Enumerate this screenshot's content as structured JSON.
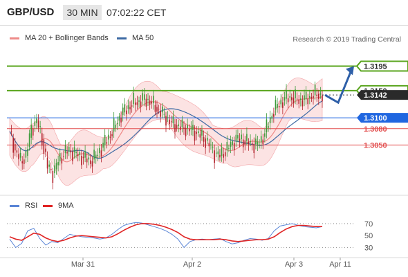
{
  "header": {
    "pair": "GBP/USD",
    "timeframe": "30 MIN",
    "time": "07:02:22 CET"
  },
  "legend": {
    "ma20_label": "MA 20 + Bollinger Bands",
    "ma50_label": "MA 50",
    "ma20_color": "#ee8a88",
    "ma50_color": "#3d6aa3",
    "copyright": "Research © 2019 Trading Central"
  },
  "rsi_legend": {
    "rsi_label": "RSI",
    "ma9_label": "9MA",
    "rsi_color": "#5b86d6",
    "ma9_color": "#e02424"
  },
  "chart_data": [
    {
      "type": "candlestick",
      "title": "GBP/USD",
      "xlabel": "",
      "ylabel": "",
      "x_ticks": [
        "Mar 31",
        "Apr 2",
        "Apr 3",
        "Apr 11"
      ],
      "levels": [
        {
          "label": "1.3195",
          "value": 1.3195,
          "color": "#5aa51e",
          "kind": "target"
        },
        {
          "label": "1.3150",
          "value": 1.315,
          "color": "#5aa51e",
          "kind": "target"
        },
        {
          "label": "1.3142",
          "value": 1.3142,
          "color": "#2a2a2a",
          "kind": "last"
        },
        {
          "label": "1.3100",
          "value": 1.31,
          "color": "#1f66e0",
          "kind": "pivot"
        },
        {
          "label": "1.3080",
          "value": 1.308,
          "color": "#e24d4d",
          "kind": "support"
        },
        {
          "label": "1.3050",
          "value": 1.305,
          "color": "#e24d4d",
          "kind": "support"
        }
      ],
      "price_path": [
        1.3075,
        1.304,
        1.302,
        1.303,
        1.308,
        1.3095,
        1.306,
        1.301,
        1.2998,
        1.302,
        1.3035,
        1.304,
        1.3035,
        1.303,
        1.3025,
        1.302,
        1.303,
        1.3045,
        1.306,
        1.3075,
        1.3095,
        1.311,
        1.312,
        1.3128,
        1.313,
        1.3135,
        1.313,
        1.312,
        1.311,
        1.31,
        1.309,
        1.3085,
        1.3082,
        1.308,
        1.3076,
        1.307,
        1.3062,
        1.305,
        1.3035,
        1.303,
        1.304,
        1.305,
        1.3062,
        1.306,
        1.3056,
        1.3052,
        1.305,
        1.3065,
        1.309,
        1.3115,
        1.3125,
        1.3135,
        1.3138,
        1.3135,
        1.3132,
        1.3135,
        1.314,
        1.3144,
        1.314
      ],
      "projection": [
        1.3142,
        1.3128,
        1.3195
      ],
      "bollinger": {
        "upper_offset": 0.004,
        "lower_offset": 0.004
      },
      "ylim": [
        1.296,
        1.3225
      ]
    },
    {
      "type": "line",
      "title": "RSI",
      "series": [
        {
          "name": "RSI",
          "values": [
            44,
            30,
            37,
            58,
            62,
            45,
            34,
            40,
            38,
            45,
            52,
            50,
            48,
            47,
            46,
            44,
            46,
            52,
            60,
            67,
            70,
            72,
            71,
            68,
            65,
            62,
            58,
            52,
            44,
            30,
            40,
            43,
            44,
            43,
            44,
            45,
            40,
            36,
            38,
            42,
            45,
            44,
            42,
            45,
            58,
            66,
            68,
            70,
            67,
            65,
            64,
            63,
            65
          ]
        },
        {
          "name": "9MA",
          "values": [
            48,
            44,
            42,
            48,
            54,
            52,
            46,
            42,
            40,
            42,
            46,
            49,
            50,
            49,
            48,
            47,
            46,
            48,
            53,
            59,
            64,
            68,
            70,
            70,
            69,
            67,
            64,
            60,
            55,
            48,
            44,
            43,
            43,
            43,
            43,
            44,
            43,
            41,
            40,
            41,
            42,
            43,
            43,
            44,
            48,
            55,
            61,
            65,
            67,
            67,
            66,
            65,
            65
          ]
        }
      ],
      "y_ticks": [
        30,
        50,
        70
      ],
      "ylim": [
        20,
        85
      ]
    }
  ]
}
